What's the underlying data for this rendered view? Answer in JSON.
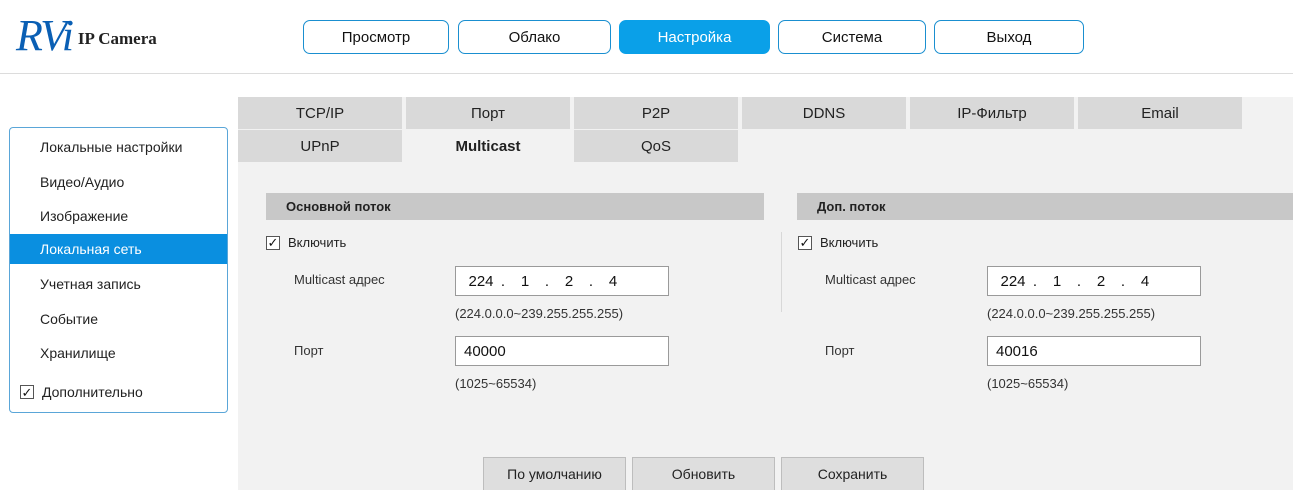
{
  "header": {
    "logo_mark": "RVi",
    "logo_text": "IP Camera"
  },
  "topnav": [
    {
      "label": "Просмотр",
      "active": false
    },
    {
      "label": "Облако",
      "active": false
    },
    {
      "label": "Настройка",
      "active": true
    },
    {
      "label": "Система",
      "active": false
    },
    {
      "label": "Выход",
      "active": false
    }
  ],
  "sidebar": {
    "items": [
      {
        "label": "Локальные настройки"
      },
      {
        "label": "Видео/Аудио"
      },
      {
        "label": "Изображение"
      },
      {
        "label": "Локальная сеть",
        "active": true
      },
      {
        "label": "Учетная запись"
      },
      {
        "label": "Событие"
      },
      {
        "label": "Хранилище"
      }
    ],
    "extra_label": "Дополнительно",
    "extra_checked": true
  },
  "tabs": {
    "row1": [
      "TCP/IP",
      "Порт",
      "P2P",
      "DDNS",
      "IP-Фильтр",
      "Email"
    ],
    "row2": [
      "UPnP",
      "Multicast",
      "QoS"
    ],
    "active": "Multicast"
  },
  "main_stream": {
    "title": "Основной поток",
    "enable_label": "Включить",
    "enabled": true,
    "address_label": "Multicast адрес",
    "address": [
      "224",
      "1",
      "2",
      "4"
    ],
    "address_range": "(224.0.0.0~239.255.255.255)",
    "port_label": "Порт",
    "port": "40000",
    "port_range": "(1025~65534)"
  },
  "sub_stream": {
    "title": "Доп. поток",
    "enable_label": "Включить",
    "enabled": true,
    "address_label": "Multicast адрес",
    "address": [
      "224",
      "1",
      "2",
      "4"
    ],
    "address_range": "(224.0.0.0~239.255.255.255)",
    "port_label": "Порт",
    "port": "40016",
    "port_range": "(1025~65534)"
  },
  "actions": {
    "default_label": "По умолчанию",
    "refresh_label": "Обновить",
    "save_label": "Сохранить"
  },
  "colors": {
    "accent": "#0aa0e8",
    "sidebar_active": "#0a8fe0",
    "brand": "#0a5fb4"
  }
}
